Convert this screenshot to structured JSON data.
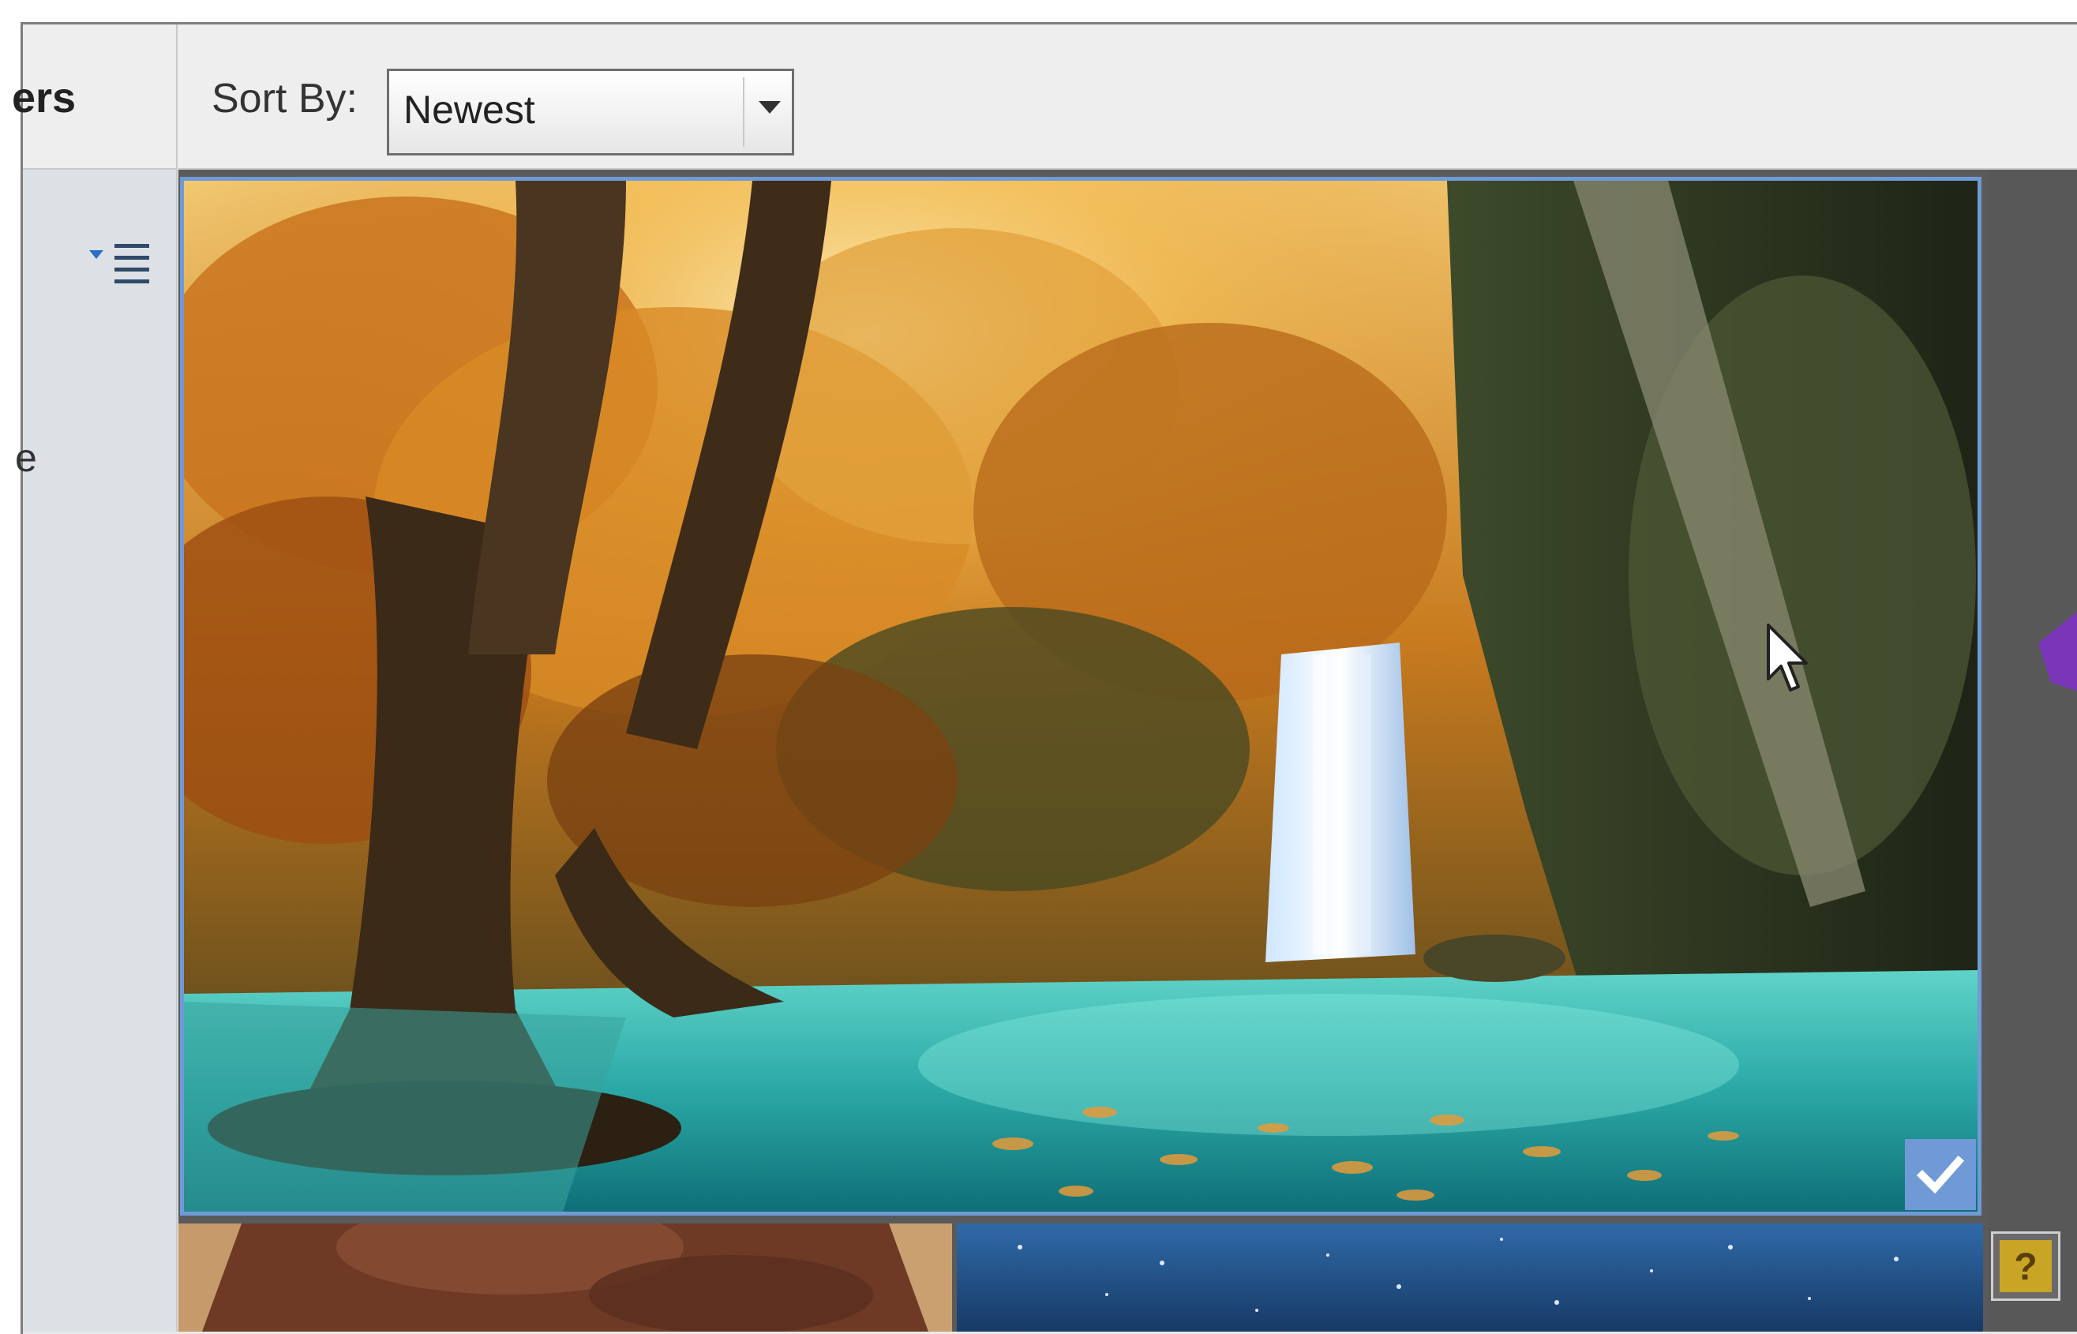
{
  "panel": {
    "title": "ers",
    "item_fragment": "e"
  },
  "toolbar": {
    "sort_label": "Sort By:",
    "sort_value": "Newest"
  },
  "gallery": {
    "selected_index": 0
  },
  "icons": {
    "list_menu": "list-menu-icon",
    "dropdown": "chevron-down-icon",
    "selected": "checkmark-icon",
    "help": "help-icon",
    "pointer": "mouse-pointer-icon"
  },
  "colors": {
    "selection": "#6f9ad6",
    "panel_bg": "#dde1e6",
    "toolbar_bg": "#eeeeee",
    "grid_bg": "#5a5a5a"
  }
}
